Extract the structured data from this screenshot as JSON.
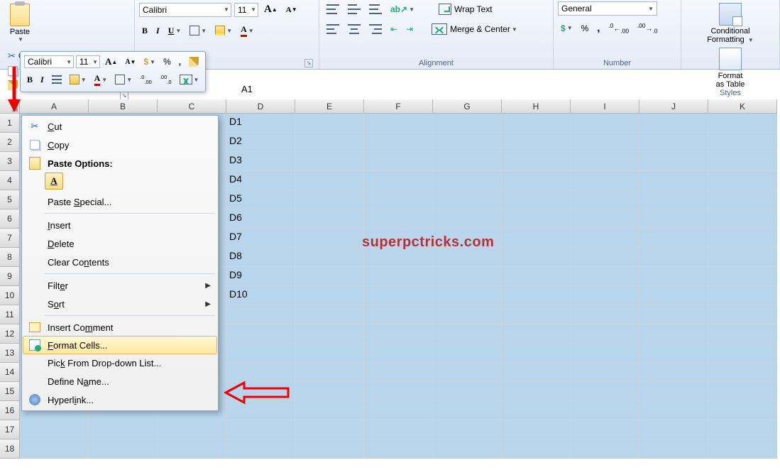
{
  "ribbon": {
    "clipboard": {
      "paste": "Paste",
      "cut": "Cut",
      "copy": "Copy",
      "format_painter": "Format Painter"
    },
    "font": {
      "name": "Calibri",
      "size": "11",
      "bold": "B",
      "italic": "I",
      "underline": "U"
    },
    "alignment": {
      "label": "Alignment",
      "wrap": "Wrap Text",
      "merge": "Merge & Center"
    },
    "number": {
      "label": "Number",
      "format": "General",
      "currency": "$",
      "percent": "%",
      "comma": ",",
      "inc_dec": ".0",
      "dec_dec": ".00"
    },
    "styles": {
      "label": "Styles",
      "cond_fmt": "Conditional Formatting",
      "fmt_table": "Format as Table"
    }
  },
  "mini": {
    "font": "Calibri",
    "size": "11",
    "percent": "%",
    "comma": ","
  },
  "formula_bar": {
    "cell_ref": "A1"
  },
  "grid": {
    "columns": [
      "A",
      "B",
      "C",
      "D",
      "E",
      "F",
      "G",
      "H",
      "I",
      "J",
      "K"
    ],
    "rows": [
      "1",
      "2",
      "3",
      "4",
      "5",
      "6",
      "7",
      "8",
      "9",
      "10",
      "11",
      "12",
      "13",
      "14",
      "15",
      "16",
      "17",
      "18"
    ],
    "col_d_values": [
      "D1",
      "D2",
      "D3",
      "D4",
      "D5",
      "D6",
      "D7",
      "D8",
      "D9",
      "D10"
    ]
  },
  "context_menu": {
    "cut": "Cut",
    "copy": "Copy",
    "paste_options": "Paste Options:",
    "paste_special": "Paste Special...",
    "insert": "Insert",
    "delete": "Delete",
    "clear_contents": "Clear Contents",
    "filter": "Filter",
    "sort": "Sort",
    "insert_comment": "Insert Comment",
    "format_cells": "Format Cells...",
    "pick_list": "Pick From Drop-down List...",
    "define_name": "Define Name...",
    "hyperlink": "Hyperlink..."
  },
  "watermark": "superpctricks.com"
}
